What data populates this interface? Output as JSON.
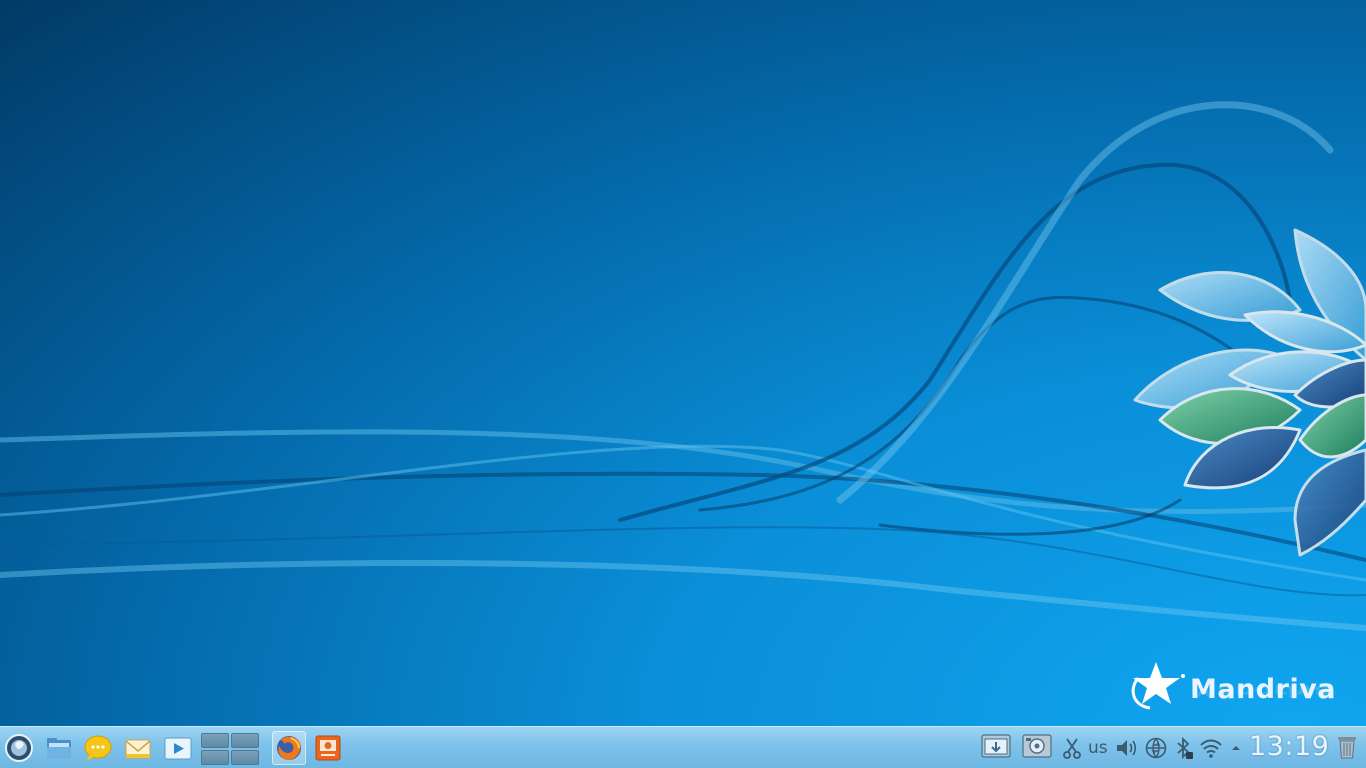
{
  "desktop": {
    "wallpaper": "Mandriva blue wallpaper with flowing lines and leaf flower",
    "brand": "Mandriva"
  },
  "taskbar": {
    "launcher": {
      "icon": "application-launcher-icon"
    },
    "quicklaunch": [
      {
        "name": "file-manager",
        "icon": "folder-icon"
      },
      {
        "name": "chat",
        "icon": "chat-bubble-icon"
      },
      {
        "name": "mail",
        "icon": "mail-envelope-icon"
      },
      {
        "name": "media-player",
        "icon": "play-icon"
      }
    ],
    "pager": {
      "desktops": 4,
      "active": 1
    },
    "tasks": [
      {
        "name": "firefox",
        "icon": "firefox-icon",
        "active": true
      },
      {
        "name": "presentation",
        "icon": "presentation-icon",
        "active": false
      }
    ],
    "tray": {
      "keyboard_layout": "us",
      "clock": "13:19"
    }
  },
  "colors": {
    "taskbar_top": "#9bd3f3",
    "taskbar_bottom": "#6db7e3",
    "wallpaper_dark": "#023a66",
    "wallpaper_light": "#10a6f0"
  }
}
